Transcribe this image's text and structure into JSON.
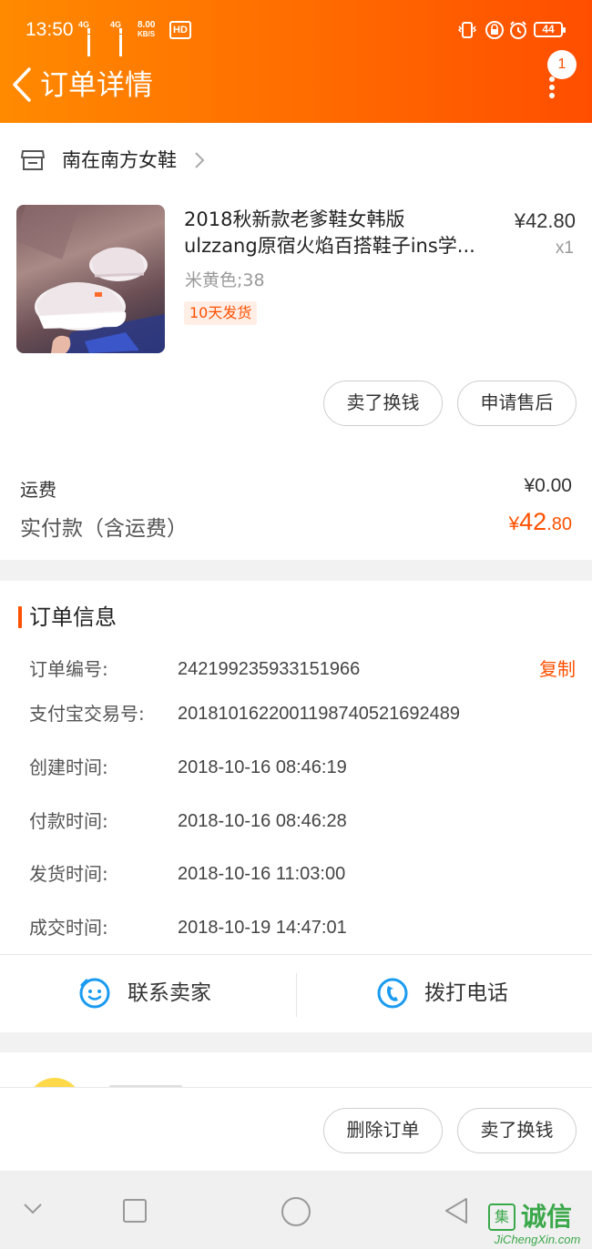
{
  "status_bar": {
    "time": "13:50",
    "signal1_label": "4G",
    "signal2_label": "4G",
    "net_speed_value": "8.00",
    "net_speed_unit": "KB/S",
    "hd_label": "HD",
    "battery": "44"
  },
  "header": {
    "title": "订单详情",
    "notification_count": "1"
  },
  "store": {
    "name": "南在南方女鞋"
  },
  "product": {
    "title_line1": "2018秋新款老爹鞋女韩版",
    "title_line2": "ulzzang原宿火焰百搭鞋子ins学...",
    "price": "¥42.80",
    "quantity": "x1",
    "sku": "米黄色;38",
    "shipping_badge": "10天发货"
  },
  "product_actions": {
    "sell_label": "卖了换钱",
    "after_sale_label": "申请售后"
  },
  "cost": {
    "shipping_label": "运费",
    "shipping_value": "¥0.00",
    "paid_label": "实付款（含运费）",
    "paid_currency": "¥",
    "paid_integer": "42",
    "paid_decimal": ".80"
  },
  "order_info": {
    "title": "订单信息",
    "copy_label": "复制",
    "rows": [
      {
        "label": "订单编号:",
        "value": "242199235933151966"
      },
      {
        "label": "支付宝交易号:",
        "value": "2018101622001198740521692489"
      },
      {
        "label": "创建时间:",
        "value": "2018-10-16 08:46:19"
      },
      {
        "label": "付款时间:",
        "value": "2018-10-16 08:46:28"
      },
      {
        "label": "发货时间:",
        "value": "2018-10-16 11:03:00"
      },
      {
        "label": "成交时间:",
        "value": "2018-10-19 14:47:01"
      }
    ]
  },
  "contact": {
    "seller_label": "联系卖家",
    "call_label": "拨打电话"
  },
  "bottom_actions": {
    "delete_label": "删除订单",
    "sell_label": "卖了换钱"
  },
  "watermark": {
    "cn": "诚信",
    "en": "JiChengXin.com"
  },
  "theme": {
    "accent": "#ff5000",
    "header_start": "#ff8a00",
    "header_end": "#ff4e00",
    "contact_icon": "#1a9bf0"
  }
}
